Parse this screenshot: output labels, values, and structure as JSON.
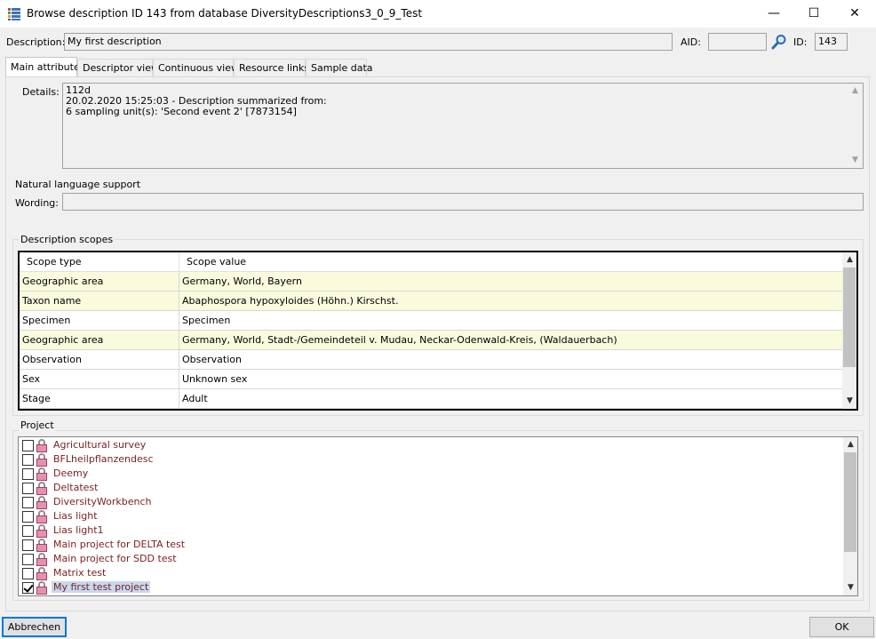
{
  "window": {
    "title": "Browse description ID 143 from database DiversityDescriptions3_0_9_Test",
    "minimize": "—",
    "maximize": "☐",
    "close": "✕"
  },
  "header": {
    "description_label": "Description:",
    "description_value": "My first description",
    "aid_label": "AID:",
    "aid_value": "",
    "id_label": "ID:",
    "id_value": "143"
  },
  "tabs": [
    "Main attributes",
    "Descriptor view",
    "Continuous view",
    "Resource links",
    "Sample data"
  ],
  "details": {
    "label": "Details:",
    "lines": [
      "112d",
      "20.02.2020 15:25:03 - Description summarized from:",
      "6 sampling unit(s): 'Second event 2' [7873154]"
    ]
  },
  "natural_language": {
    "title": "Natural language support",
    "wording_label": "Wording:",
    "wording_value": ""
  },
  "scopes": {
    "title": "Description scopes",
    "columns": [
      "Scope type",
      "Scope value"
    ],
    "rows": [
      {
        "type": "Geographic area",
        "value": "Germany, World, Bayern",
        "highlight": true
      },
      {
        "type": "Taxon name",
        "value": "Abaphospora hypoxyloides (Höhn.) Kirschst.",
        "highlight": true
      },
      {
        "type": "Specimen",
        "value": "Specimen",
        "highlight": false
      },
      {
        "type": "Geographic area",
        "value": "Germany, World, Stadt-/Gemeindeteil v. Mudau, Neckar-Odenwald-Kreis, (Waldauerbach)",
        "highlight": true
      },
      {
        "type": "Observation",
        "value": "Observation",
        "highlight": false
      },
      {
        "type": "Sex",
        "value": "Unknown sex",
        "highlight": false
      },
      {
        "type": "Stage",
        "value": "Adult",
        "highlight": false
      }
    ]
  },
  "project": {
    "title": "Project",
    "items": [
      {
        "label": "Agricultural survey",
        "checked": false,
        "selected": false
      },
      {
        "label": "BFLheilpflanzendesc",
        "checked": false,
        "selected": false
      },
      {
        "label": "Deemy",
        "checked": false,
        "selected": false
      },
      {
        "label": "Deltatest",
        "checked": false,
        "selected": false
      },
      {
        "label": "DiversityWorkbench",
        "checked": false,
        "selected": false
      },
      {
        "label": "Lias light",
        "checked": false,
        "selected": false
      },
      {
        "label": "Lias light1",
        "checked": false,
        "selected": false
      },
      {
        "label": "Main project for DELTA test",
        "checked": false,
        "selected": false
      },
      {
        "label": "Main project for SDD test",
        "checked": false,
        "selected": false
      },
      {
        "label": "Matrix test",
        "checked": false,
        "selected": false
      },
      {
        "label": "My first test project",
        "checked": true,
        "selected": true
      }
    ]
  },
  "buttons": {
    "cancel": "Abbrechen",
    "ok": "OK"
  },
  "icons": {
    "app": "grid-app-icon",
    "search": "magnifier-icon",
    "lock": "lock-icon"
  },
  "colors": {
    "row_highlight": "#fafadc",
    "project_text": "#7b1f1f",
    "selection": "#c8d8ee",
    "focus_border": "#0078d7"
  }
}
